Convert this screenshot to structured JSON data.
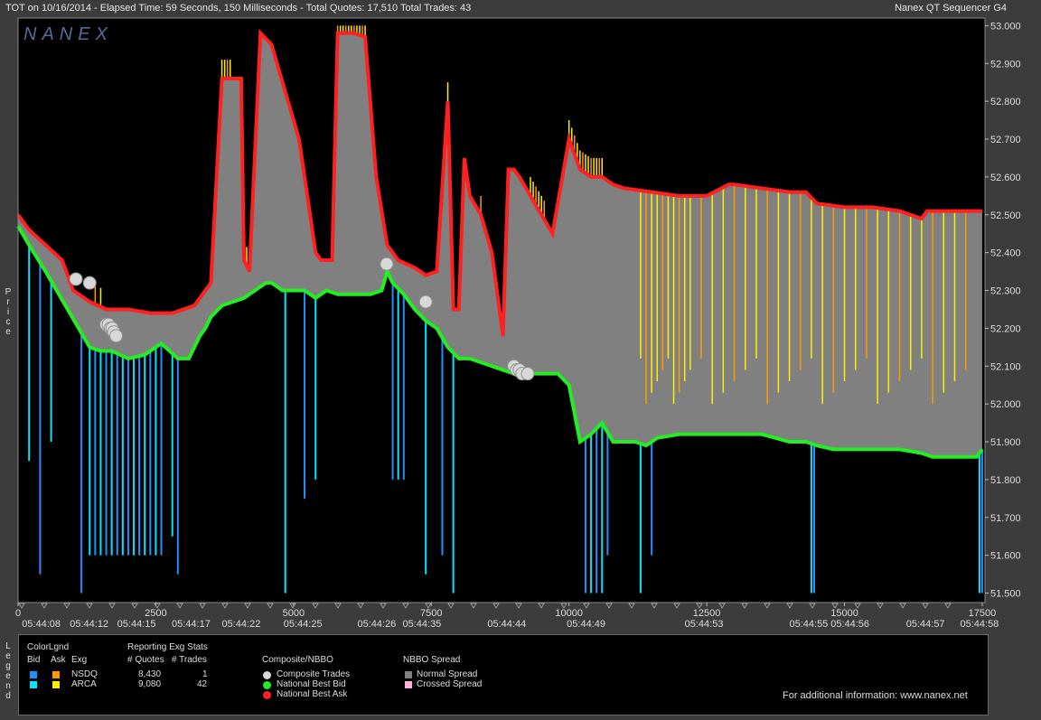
{
  "header": {
    "left": "TOT on 10/16/2014  -  Elapsed Time: 59 Seconds, 150 Milliseconds  -  Total Quotes: 17,510  Total Trades: 43",
    "right": "Nanex QT Sequencer G4"
  },
  "watermark": "NANEX",
  "axis_title_price": "Price",
  "chart_data": {
    "type": "line",
    "title": "",
    "xlabel": "",
    "ylabel": "Price",
    "xlim": [
      0,
      17550
    ],
    "ylim": [
      51.475,
      53.02
    ],
    "y_ticks": [
      "53.000",
      "52.900",
      "52.800",
      "52.700",
      "52.600",
      "52.500",
      "52.400",
      "52.300",
      "52.200",
      "52.100",
      "52.000",
      "51.900",
      "51.800",
      "51.700",
      "51.600",
      "51.500"
    ],
    "x_ticks": [
      "0",
      "2500",
      "5000",
      "7500",
      "10000",
      "12500",
      "15000",
      "17500"
    ],
    "x_time_labels": [
      {
        "x": 420,
        "t": "05:44:08"
      },
      {
        "x": 1290,
        "t": "05:44:12"
      },
      {
        "x": 2150,
        "t": "05:44:15"
      },
      {
        "x": 3140,
        "t": "05:44:17"
      },
      {
        "x": 4050,
        "t": "05:44:22"
      },
      {
        "x": 5170,
        "t": "05:44:25"
      },
      {
        "x": 6510,
        "t": "05:44:26"
      },
      {
        "x": 7330,
        "t": "05:44:35"
      },
      {
        "x": 8870,
        "t": "05:44:44"
      },
      {
        "x": 10310,
        "t": "05:44:49"
      },
      {
        "x": 12450,
        "t": "05:44:53"
      },
      {
        "x": 14350,
        "t": "05:44:55"
      },
      {
        "x": 15100,
        "t": "05:44:56"
      },
      {
        "x": 16470,
        "t": "05:44:57"
      },
      {
        "x": 17450,
        "t": "05:44:58"
      }
    ],
    "series": [
      {
        "name": "National Best Ask",
        "color": "#ff2020",
        "x": [
          0,
          200,
          500,
          800,
          1000,
          1300,
          1600,
          2000,
          2400,
          2800,
          3200,
          3400,
          3500,
          3700,
          3900,
          4050,
          4100,
          4200,
          4400,
          4600,
          4800,
          5100,
          5200,
          5400,
          5500,
          5600,
          5700,
          5800,
          5900,
          6100,
          6300,
          6500,
          6700,
          6900,
          7200,
          7400,
          7600,
          7800,
          7900,
          8000,
          8100,
          8200,
          8400,
          8600,
          8800,
          8900,
          9000,
          9100,
          9300,
          9500,
          9700,
          10000,
          10200,
          10400,
          10600,
          10800,
          11000,
          11500,
          12000,
          12500,
          12900,
          13000,
          13500,
          14000,
          14300,
          14500,
          15000,
          15500,
          16000,
          16400,
          16500,
          17000,
          17300,
          17400,
          17500
        ],
        "y": [
          52.5,
          52.46,
          52.42,
          52.38,
          52.3,
          52.27,
          52.25,
          52.25,
          52.24,
          52.24,
          52.26,
          52.3,
          52.32,
          52.86,
          52.86,
          52.86,
          52.38,
          52.35,
          52.98,
          52.95,
          52.85,
          52.7,
          52.6,
          52.4,
          52.38,
          52.38,
          52.38,
          52.98,
          52.98,
          52.98,
          52.97,
          52.6,
          52.42,
          52.38,
          52.36,
          52.34,
          52.35,
          52.8,
          52.25,
          52.25,
          52.65,
          52.55,
          52.5,
          52.4,
          52.18,
          52.62,
          52.62,
          52.6,
          52.55,
          52.5,
          52.45,
          52.7,
          52.62,
          52.6,
          52.6,
          52.58,
          52.57,
          52.56,
          52.55,
          52.55,
          52.58,
          52.58,
          52.57,
          52.56,
          52.56,
          52.53,
          52.52,
          52.52,
          52.51,
          52.49,
          52.51,
          52.51,
          52.51,
          52.51,
          52.51
        ]
      },
      {
        "name": "National Best Bid",
        "color": "#22ee22",
        "x": [
          0,
          200,
          500,
          700,
          900,
          1100,
          1300,
          1500,
          1700,
          2000,
          2300,
          2600,
          2900,
          3100,
          3300,
          3400,
          3500,
          3700,
          3900,
          4100,
          4300,
          4500,
          4600,
          4800,
          5000,
          5200,
          5400,
          5500,
          5600,
          5800,
          6000,
          6400,
          6600,
          6700,
          6800,
          7000,
          7200,
          7400,
          7600,
          7800,
          8000,
          8200,
          8400,
          8600,
          8800,
          9000,
          9200,
          9400,
          9600,
          9800,
          10000,
          10200,
          10400,
          10600,
          10800,
          11000,
          11200,
          11400,
          11600,
          12000,
          12500,
          13000,
          13500,
          14000,
          14300,
          14500,
          14800,
          15500,
          16000,
          16400,
          16600,
          17000,
          17300,
          17400,
          17500
        ],
        "y": [
          52.47,
          52.42,
          52.35,
          52.3,
          52.25,
          52.2,
          52.15,
          52.14,
          52.14,
          52.12,
          52.13,
          52.16,
          52.12,
          52.12,
          52.18,
          52.2,
          52.23,
          52.26,
          52.27,
          52.28,
          52.3,
          52.32,
          52.32,
          52.3,
          52.3,
          52.3,
          52.28,
          52.29,
          52.3,
          52.29,
          52.29,
          52.29,
          52.3,
          52.35,
          52.32,
          52.29,
          52.25,
          52.22,
          52.2,
          52.15,
          52.12,
          52.12,
          52.11,
          52.1,
          52.09,
          52.08,
          52.08,
          52.08,
          52.08,
          52.08,
          52.05,
          51.9,
          51.92,
          51.95,
          51.9,
          51.9,
          51.9,
          51.89,
          51.91,
          51.92,
          51.92,
          51.92,
          51.92,
          51.9,
          51.9,
          51.89,
          51.88,
          51.88,
          51.88,
          51.87,
          51.86,
          51.86,
          51.86,
          51.86,
          51.88
        ]
      },
      {
        "name": "Composite Trades",
        "color": "#d8d8d8",
        "x": [
          1050,
          1300,
          1600,
          1640,
          1680,
          1710,
          1740,
          1780,
          6690,
          7400,
          9000,
          9050,
          9100,
          9150,
          9250
        ],
        "y": [
          52.33,
          52.32,
          52.21,
          52.21,
          52.2,
          52.2,
          52.19,
          52.18,
          52.37,
          52.27,
          52.1,
          52.09,
          52.09,
          52.08,
          52.08
        ]
      }
    ],
    "legend": {
      "color_legend_title": "ColorLgnd",
      "col_bid": "Bid",
      "col_ask": "Ask",
      "col_exg": "Exg",
      "stats_title": "Reporting Exg Stats",
      "col_quotes": "# Quotes",
      "col_trades": "# Trades",
      "exchanges": [
        {
          "name": "NSDQ",
          "bid_color": "#1e90ff",
          "ask_color": "#ff9900",
          "quotes": "8,430",
          "trades": "1"
        },
        {
          "name": "ARCA",
          "bid_color": "#00e5ff",
          "ask_color": "#ffee00",
          "quotes": "9,080",
          "trades": "42"
        }
      ],
      "composite_title": "Composite/NBBO",
      "composite_items": [
        {
          "label": "Composite Trades",
          "color": "#d8d8d8"
        },
        {
          "label": "National Best Bid",
          "color": "#22ee22"
        },
        {
          "label": "National Best Ask",
          "color": "#ff2020"
        }
      ],
      "spread_title": "NBBO Spread",
      "spread_items": [
        {
          "label": "Normal Spread",
          "color": "#808080"
        },
        {
          "label": "Crossed Spread",
          "color": "#ffb0e0"
        }
      ],
      "info": "For additional information: www.nanex.net"
    }
  }
}
